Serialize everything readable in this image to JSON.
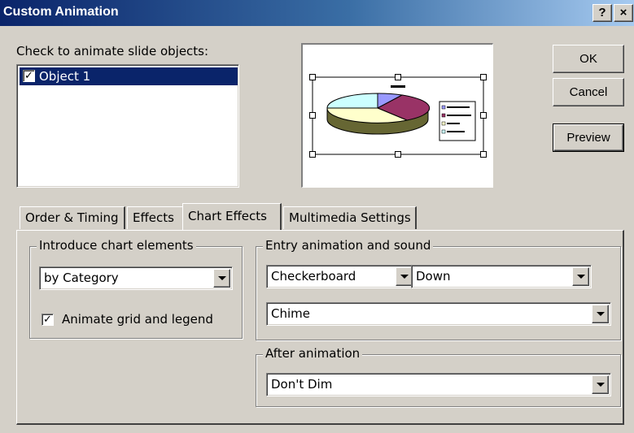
{
  "window": {
    "title": "Custom Animation"
  },
  "titlebar": {
    "help_label": "?",
    "close_label": "×"
  },
  "objects": {
    "label": "Check to animate slide objects:",
    "items": [
      {
        "label": "Object 1",
        "checked": true
      }
    ]
  },
  "buttons": {
    "ok": "OK",
    "cancel": "Cancel",
    "preview": "Preview"
  },
  "tabs": [
    {
      "label": "Order & Timing",
      "active": false
    },
    {
      "label": "Effects",
      "active": false
    },
    {
      "label": "Chart Effects",
      "active": true
    },
    {
      "label": "Multimedia Settings",
      "active": false
    }
  ],
  "introduce": {
    "title": "Introduce chart elements",
    "value": "by Category",
    "animate_grid_label": "Animate grid and legend",
    "animate_grid_checked": true
  },
  "entry": {
    "title": "Entry animation and sound",
    "effect": "Checkerboard",
    "direction": "Down",
    "sound": "Chime"
  },
  "after": {
    "title": "After animation",
    "value": "Don't Dim"
  },
  "colors": {
    "dialog_bg": "#d4d0c8",
    "title_start": "#0a246a",
    "title_end": "#a6caf0",
    "selection": "#0a246a",
    "pie_blue": "#9999ff",
    "pie_purple": "#993366",
    "pie_yellow": "#ffffcc",
    "pie_cyan": "#ccffff"
  },
  "icons": {
    "help": "help-icon",
    "close": "close-icon",
    "dropdown": "chevron-down-icon",
    "checkmark": "checkmark-icon"
  }
}
